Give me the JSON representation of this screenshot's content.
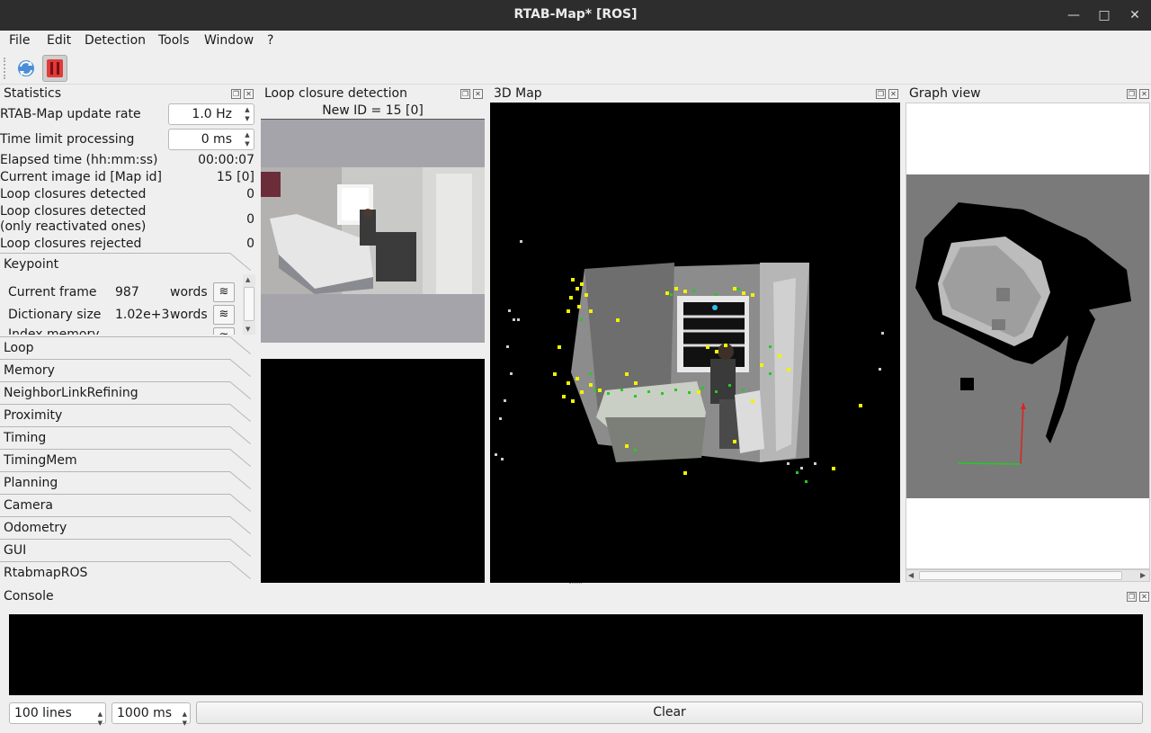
{
  "window": {
    "title": "RTAB-Map* [ROS]"
  },
  "menu": [
    "File",
    "Edit",
    "Detection",
    "Tools",
    "Window",
    "?"
  ],
  "toolbar": {
    "refresh_icon": "refresh-icon",
    "pause_icon": "pause-icon"
  },
  "docks": {
    "statistics": "Statistics",
    "loop_closure": "Loop closure detection",
    "map3d": "3D Map",
    "graph": "Graph view",
    "console": "Console"
  },
  "loop_closure": {
    "new_id": "New ID = 15 [0]"
  },
  "stats": {
    "update_rate_label": "RTAB-Map update rate",
    "update_rate": "1.0 Hz",
    "time_limit_label": "Time limit processing",
    "time_limit": "0 ms",
    "elapsed_label": "Elapsed time (hh:mm:ss)",
    "elapsed": "00:00:07",
    "image_id_label": "Current image id [Map id]",
    "image_id": "15 [0]",
    "loop_detected_label": "Loop closures detected",
    "loop_detected": "0",
    "loop_reactivated_label_1": "Loop closures detected",
    "loop_reactivated_label_2": "(only reactivated ones)",
    "loop_reactivated": "0",
    "loop_rejected_label": "Loop closures rejected",
    "loop_rejected": "0"
  },
  "keypoint": {
    "title": "Keypoint",
    "rows": [
      {
        "label": "Current frame",
        "value": "987",
        "unit": "words"
      },
      {
        "label": "Dictionary size",
        "value": "1.02e+3",
        "unit": "words"
      },
      {
        "label": "Index memory",
        "value": "",
        "unit": ""
      }
    ]
  },
  "tabs": [
    "Loop",
    "Memory",
    "NeighborLinkRefining",
    "Proximity",
    "Timing",
    "TimingMem",
    "Planning",
    "Camera",
    "Odometry",
    "GUI",
    "RtabmapROS"
  ],
  "console": {
    "lines": "100 lines",
    "interval": "1000 ms",
    "clear": "Clear"
  },
  "colors": {
    "titlebar": "#2d2d2d",
    "features_yellow": "#f2f200",
    "features_green": "#22cc22",
    "pose_red": "#dd2222"
  }
}
